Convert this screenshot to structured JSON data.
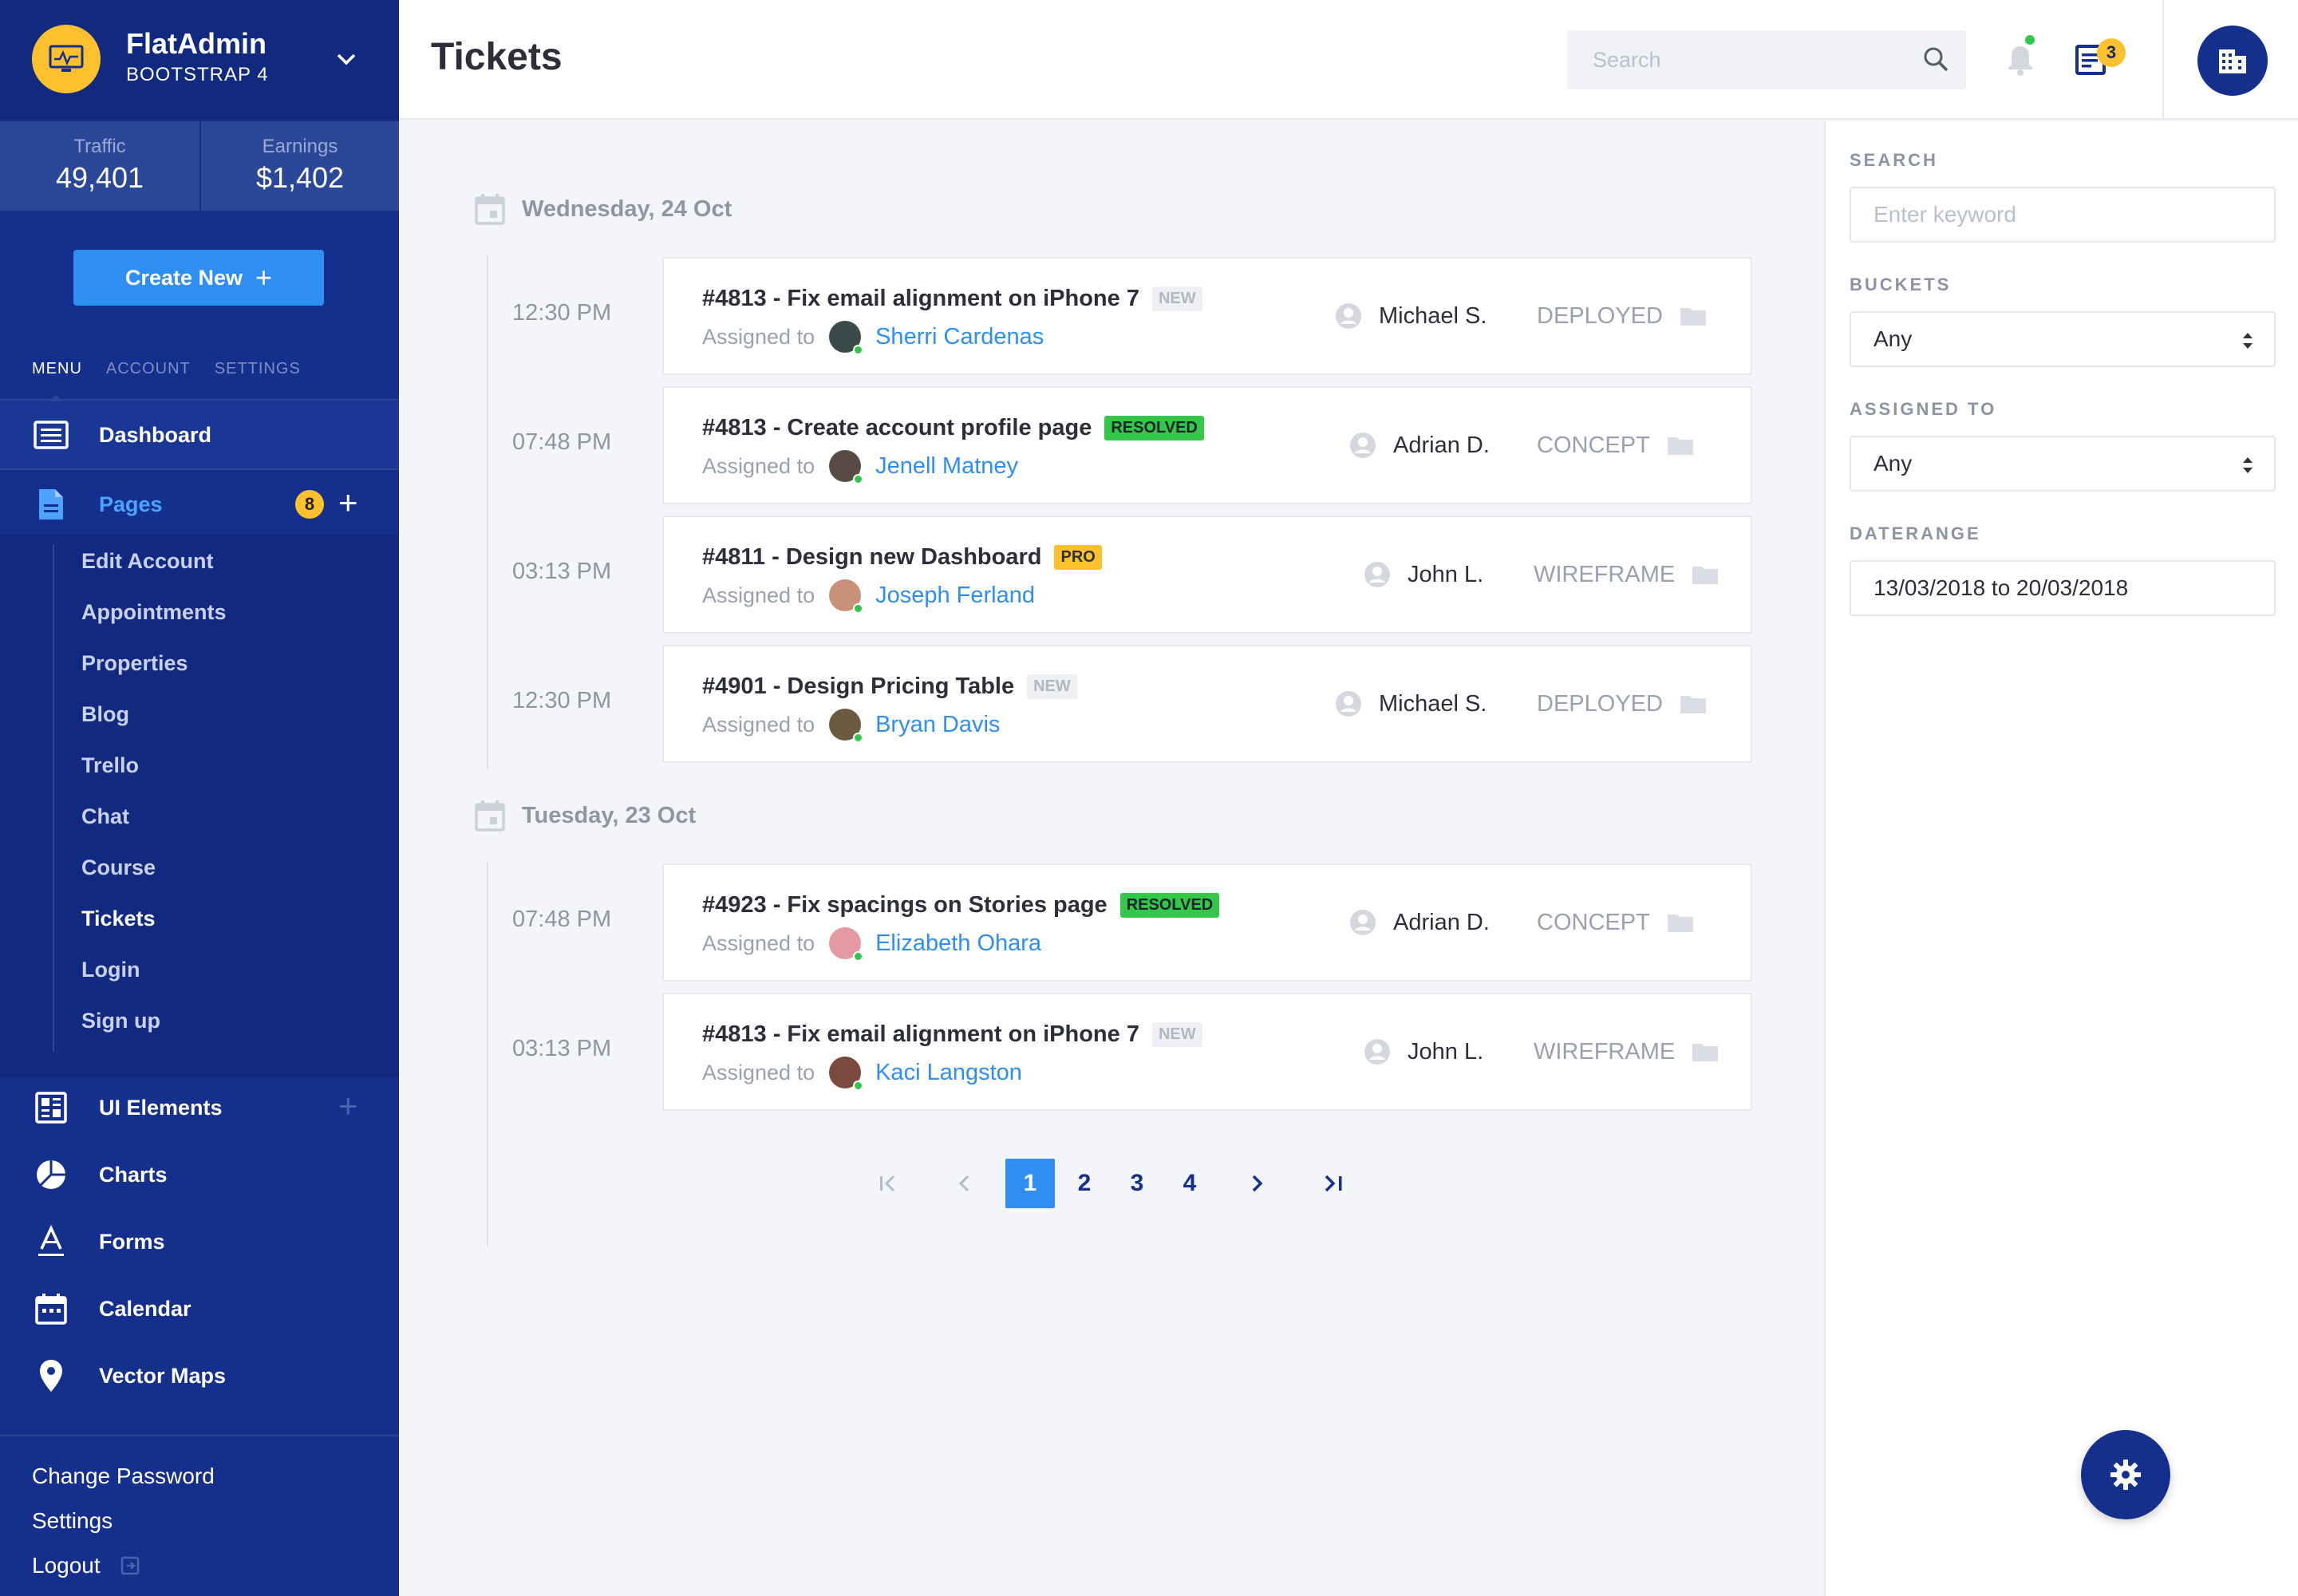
{
  "brand": {
    "name": "FlatAdmin",
    "sub": "BOOTSTRAP 4"
  },
  "stats": [
    {
      "label": "Traffic",
      "value": "49,401"
    },
    {
      "label": "Earnings",
      "value": "$1,402"
    }
  ],
  "create_label": "Create New",
  "sidebar_tabs": [
    "MENU",
    "ACCOUNT",
    "SETTINGS"
  ],
  "nav": {
    "dashboard": "Dashboard",
    "pages": "Pages",
    "pages_badge": "8",
    "pages_sub": [
      "Edit Account",
      "Appointments",
      "Properties",
      "Blog",
      "Trello",
      "Chat",
      "Course",
      "Tickets",
      "Login",
      "Sign up"
    ],
    "ui_elements": "UI Elements",
    "charts": "Charts",
    "forms": "Forms",
    "calendar": "Calendar",
    "vector_maps": "Vector Maps"
  },
  "bottom_links": [
    "Change Password",
    "Settings",
    "Logout"
  ],
  "header": {
    "title": "Tickets",
    "search_placeholder": "Search",
    "tasks_count": "3"
  },
  "filters": {
    "search_label": "SEARCH",
    "search_placeholder": "Enter keyword",
    "buckets_label": "BUCKETS",
    "buckets_value": "Any",
    "assigned_label": "ASSIGNED TO",
    "assigned_value": "Any",
    "daterange_label": "DATERANGE",
    "daterange_value": "13/03/2018 to 20/03/2018"
  },
  "groups": [
    {
      "day": "Wednesday, 24 Oct",
      "tickets": [
        {
          "time": "12:30 PM",
          "title": "#4813 - Fix email alignment on iPhone 7",
          "badge": "NEW",
          "assigned_label": "Assigned to",
          "assignee": "Sherri Cardenas",
          "owner": "Michael S.",
          "status": "DEPLOYED"
        },
        {
          "time": "07:48 PM",
          "title": "#4813 - Create account profile page",
          "badge": "RESOLVED",
          "assigned_label": "Assigned to",
          "assignee": "Jenell Matney",
          "owner": "Adrian D.",
          "status": "CONCEPT"
        },
        {
          "time": "03:13 PM",
          "title": "#4811 - Design new Dashboard",
          "badge": "PRO",
          "assigned_label": "Assigned to",
          "assignee": "Joseph Ferland",
          "owner": "John L.",
          "status": "WIREFRAME"
        },
        {
          "time": "12:30 PM",
          "title": "#4901 - Design Pricing Table",
          "badge": "NEW",
          "assigned_label": "Assigned to",
          "assignee": "Bryan Davis",
          "owner": "Michael S.",
          "status": "DEPLOYED"
        }
      ]
    },
    {
      "day": "Tuesday, 23 Oct",
      "tickets": [
        {
          "time": "07:48 PM",
          "title": "#4923 - Fix spacings on Stories page",
          "badge": "RESOLVED",
          "assigned_label": "Assigned to",
          "assignee": "Elizabeth Ohara",
          "owner": "Adrian D.",
          "status": "CONCEPT"
        },
        {
          "time": "03:13 PM",
          "title": "#4813 - Fix email alignment on iPhone 7",
          "badge": "NEW",
          "assigned_label": "Assigned to",
          "assignee": "Kaci Langston",
          "owner": "John L.",
          "status": "WIREFRAME"
        }
      ]
    }
  ],
  "pagination": {
    "pages": [
      "1",
      "2",
      "3",
      "4"
    ],
    "current": "1"
  },
  "colors": {
    "sidebar": "#15308c",
    "accent": "#2f8ef2",
    "warning": "#fdc12e",
    "success": "#34c84a"
  }
}
